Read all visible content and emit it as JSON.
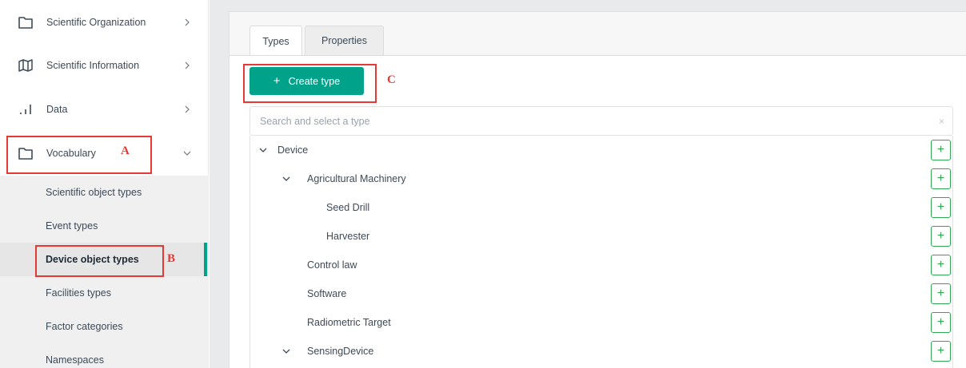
{
  "sidebar": {
    "items": [
      {
        "label": "Scientific Organization",
        "icon": "folder-icon"
      },
      {
        "label": "Scientific Information",
        "icon": "map-icon"
      },
      {
        "label": "Data",
        "icon": "bar-chart-icon"
      },
      {
        "label": "Vocabulary",
        "icon": "folder-icon",
        "expanded": true
      }
    ],
    "submenu": [
      {
        "label": "Scientific object types"
      },
      {
        "label": "Event types"
      },
      {
        "label": "Device object types",
        "active": true
      },
      {
        "label": "Facilities types"
      },
      {
        "label": "Factor categories"
      },
      {
        "label": "Namespaces"
      }
    ]
  },
  "annotations": {
    "a": "A",
    "b": "B",
    "c": "C"
  },
  "tabs": [
    {
      "label": "Types",
      "active": true
    },
    {
      "label": "Properties",
      "active": false
    }
  ],
  "create_button": {
    "plus": "+",
    "label": "Create type"
  },
  "search": {
    "placeholder": "Search and select a type",
    "value": "",
    "clear": "×"
  },
  "tree": [
    {
      "label": "Device",
      "level": 0,
      "expanded": true
    },
    {
      "label": "Agricultural Machinery",
      "level": 1,
      "expanded": true
    },
    {
      "label": "Seed Drill",
      "level": 2,
      "leaf": true
    },
    {
      "label": "Harvester",
      "level": 2,
      "leaf": true
    },
    {
      "label": "Control law",
      "level": 1,
      "leaf": true
    },
    {
      "label": "Software",
      "level": 1,
      "leaf": true
    },
    {
      "label": "Radiometric Target",
      "level": 1,
      "leaf": true
    },
    {
      "label": "SensingDevice",
      "level": 1,
      "expanded": true
    }
  ],
  "add_label": "+",
  "colors": {
    "accent": "#00a28a",
    "add_border": "#2fa84f",
    "annotation": "#e53935"
  }
}
